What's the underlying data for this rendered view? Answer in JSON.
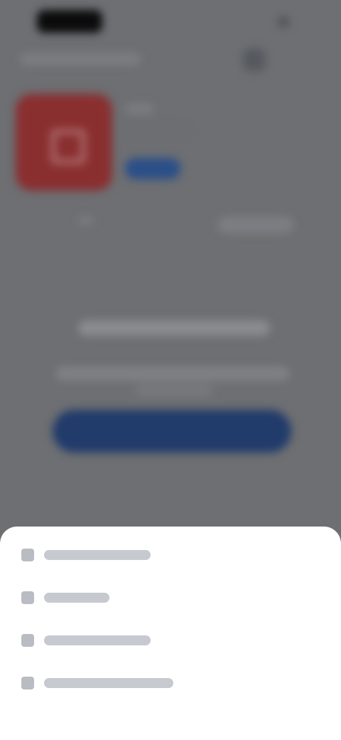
{
  "theme": {
    "background": "#6d6f72",
    "sheet_background": "#ffffff",
    "accent": "#213b6b",
    "app_icon": "#8a2f30"
  },
  "status_bar": {
    "time": "",
    "right_icon": "battery-icon"
  },
  "header": {
    "title": "",
    "action_icon": "menu-icon"
  },
  "app": {
    "icon": "app-icon",
    "title": "",
    "subtitle": "",
    "pill_label": ""
  },
  "message": {
    "title": "",
    "body": "",
    "body_line2": "",
    "cta_label": ""
  },
  "sheet": {
    "items": [
      {
        "label": "",
        "icon": "menu-item-icon"
      },
      {
        "label": "",
        "icon": "menu-item-icon"
      },
      {
        "label": "",
        "icon": "menu-item-icon"
      },
      {
        "label": "",
        "icon": "menu-item-icon"
      }
    ]
  }
}
